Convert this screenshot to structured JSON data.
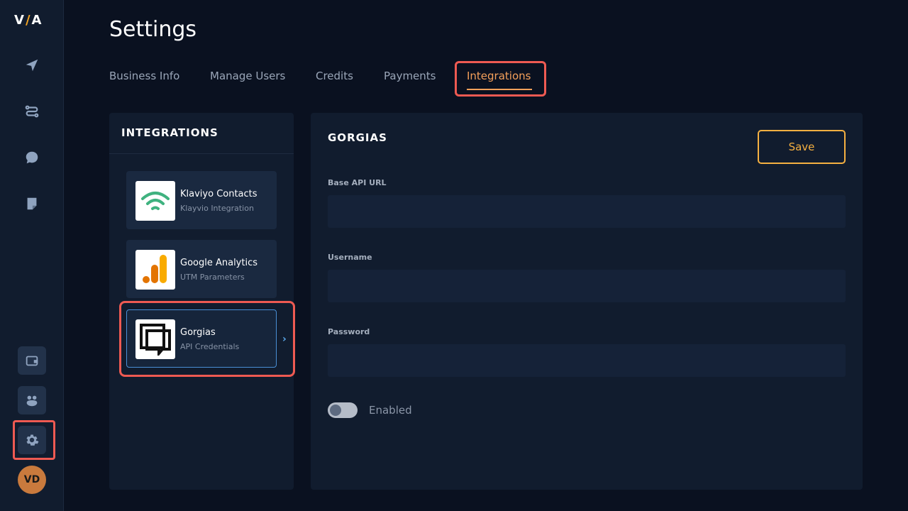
{
  "app": {
    "logo_text_left": "V",
    "logo_text_slash": "/",
    "logo_text_right": "A"
  },
  "sidebar": {
    "top_icons": [
      "send-icon",
      "route-icon",
      "chat-icon",
      "note-icon"
    ],
    "bottom_icons": [
      "wallet-icon",
      "team-icon",
      "gear-icon"
    ],
    "avatar_initials": "VD"
  },
  "page": {
    "title": "Settings"
  },
  "tabs": [
    {
      "label": "Business Info",
      "active": false
    },
    {
      "label": "Manage Users",
      "active": false
    },
    {
      "label": "Credits",
      "active": false
    },
    {
      "label": "Payments",
      "active": false
    },
    {
      "label": "Integrations",
      "active": true
    }
  ],
  "integrations_panel": {
    "header": "INTEGRATIONS",
    "items": [
      {
        "name": "Klaviyo Contacts",
        "subtitle": "Klayvio Integration",
        "icon": "wifi-icon"
      },
      {
        "name": "Google Analytics",
        "subtitle": "UTM Parameters",
        "icon": "analytics-icon"
      },
      {
        "name": "Gorgias",
        "subtitle": "API Credentials",
        "icon": "gorgias-icon",
        "selected": true
      }
    ]
  },
  "detail": {
    "title": "GORGIAS",
    "save_label": "Save",
    "fields": [
      {
        "label": "Base API URL",
        "value": ""
      },
      {
        "label": "Username",
        "value": ""
      },
      {
        "label": "Password",
        "value": ""
      }
    ],
    "toggle_label": "Enabled",
    "enabled": false
  },
  "colors": {
    "accent_orange": "#f5a05a",
    "save_border": "#f5b041",
    "highlight_red": "#ee5a52",
    "selected_border": "#4a8fd6"
  }
}
